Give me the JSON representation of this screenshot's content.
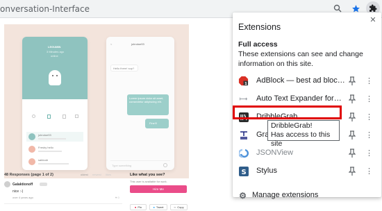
{
  "browser": {
    "url_fragment": "onversation-Interface"
  },
  "page": {
    "shot": {
      "phone1_title": "LEGUMIN",
      "phone1_sub": "3 Minutes ago",
      "phone1_sub2": "online",
      "phone1_rows": [
        "johndoe93",
        "Freshy hello",
        "sabloob"
      ],
      "phone2_header": "johndoe93",
      "phone2_msg1": "Hello there! sup?",
      "phone2_msg2": "Lorem ipsum dolor sit amet, consectetur adipiscing elit.",
      "phone2_msg3": "Fine!!!",
      "phone2_input": "Type something"
    },
    "responses": {
      "title": "48 Responses (page 1 of 2)",
      "sort_tabs": [
        "oldest",
        "newest",
        "likes"
      ],
      "commenter_name": "Galaktionoff",
      "comment": "nice :-)",
      "ago": "over 4 years ago"
    },
    "sidebar": {
      "heading": "Like what you see?",
      "sub": "This user is available for work.",
      "hire_label": "Hire Me",
      "share": [
        "Pin",
        "Tweet",
        "Copy"
      ]
    }
  },
  "extensions": {
    "title": "Extensions",
    "section_heading": "Full access",
    "section_desc": "These extensions can see and change information on this site.",
    "items": [
      {
        "name": "AdBlock — best ad bloc…",
        "icon": "adblock-icon",
        "color": "#d93025"
      },
      {
        "name": "Auto Text Expander for…",
        "icon": "text-expander-icon",
        "color": "#9aa0a6"
      },
      {
        "name": "DribbleGrab",
        "icon": "dribblegrab-icon",
        "color": "#3c3c3c"
      },
      {
        "name": "Grab",
        "icon": "grab-icon",
        "color": "#1a237e"
      },
      {
        "name": "JSONView",
        "icon": "jsonview-icon",
        "color": "#4a90d9"
      },
      {
        "name": "Stylus",
        "icon": "stylus-icon",
        "color": "#2f5d8a"
      }
    ],
    "tooltip_line1": "DribbleGrab!",
    "tooltip_line2": "Has access to this site",
    "manage_label": "Manage extensions",
    "highlight_color": "#e00000"
  }
}
